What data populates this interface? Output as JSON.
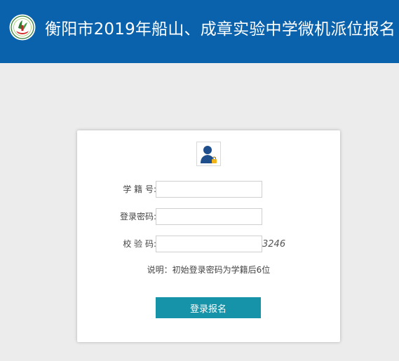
{
  "header": {
    "title": "衡阳市2019年船山、成章实验中学微机派位报名",
    "logo_icon": "school-emblem-icon",
    "background_color": "#0a62ad"
  },
  "login_card": {
    "avatar_icon": "user-avatar-icon",
    "fields": {
      "student_id": {
        "label": "学 籍 号:",
        "value": "",
        "placeholder": ""
      },
      "password": {
        "label": "登录密码:",
        "value": "",
        "placeholder": ""
      },
      "captcha": {
        "label": "校 验 码:",
        "value": "",
        "placeholder": "",
        "code": "3246"
      }
    },
    "note": "说明：初始登录密码为学籍后6位",
    "submit_label": "登录报名",
    "button_color": "#1793a9"
  },
  "page": {
    "background_color": "#ececec"
  }
}
